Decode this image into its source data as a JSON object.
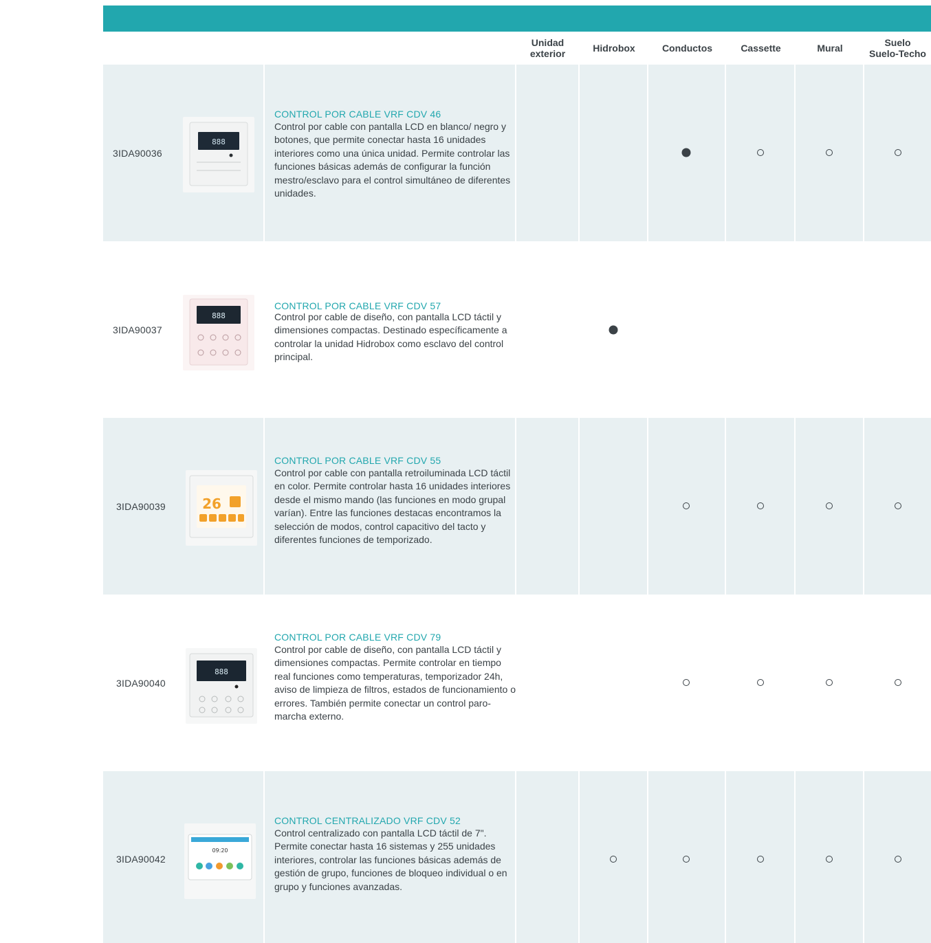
{
  "columns": {
    "unidad_exterior": "Unidad\nexterior",
    "hidrobox": "Hidrobox",
    "conductos": "Conductos",
    "cassette": "Cassette",
    "mural": "Mural",
    "suelo": "Suelo\nSuelo-Techo"
  },
  "rows": [
    {
      "code": "3IDA90036",
      "title": "CONTROL POR CABLE VRF CDV 46",
      "description": "Control por cable con pantalla LCD en blanco/ negro y botones, que permite conectar hasta 16 unidades interiores como una única unidad. Permite controlar las funciones básicas además de configurar la función mestro/esclavo para el control simultáneo de diferentes unidades.",
      "marks": {
        "unidad_exterior": "",
        "hidrobox": "",
        "conductos": "full",
        "cassette": "empty",
        "mural": "empty",
        "suelo": "empty"
      },
      "thumb_icon": "wired-controller-lcd-icon"
    },
    {
      "code": "3IDA90037",
      "title": "CONTROL POR CABLE VRF CDV 57",
      "description": "Control por cable de diseño, con pantalla LCD táctil y dimensiones compactas. Destinado específicamente a controlar la unidad Hidrobox como esclavo del control principal.",
      "marks": {
        "unidad_exterior": "",
        "hidrobox": "full",
        "conductos": "",
        "cassette": "",
        "mural": "",
        "suelo": ""
      },
      "thumb_icon": "wired-controller-pink-icon"
    },
    {
      "code": "3IDA90039",
      "title": "CONTROL POR CABLE VRF CDV 55",
      "description": "Control por cable con pantalla retroiluminada LCD táctil en color. Permite controlar hasta 16 unidades interiores desde el mismo mando (las funciones en modo grupal varían). Entre las funciones destacas encontramos la selección de modos, control capacitivo del tacto y diferentes funciones de temporizado.",
      "marks": {
        "unidad_exterior": "",
        "hidrobox": "",
        "conductos": "empty",
        "cassette": "empty",
        "mural": "empty",
        "suelo": "empty"
      },
      "thumb_icon": "color-touch-controller-icon",
      "thumb_text": "26"
    },
    {
      "code": "3IDA90040",
      "title": "CONTROL POR CABLE VRF CDV 79",
      "description": "Control por cable de diseño, con pantalla LCD táctil y dimensiones compactas. Permite controlar en tiempo real funciones como temperaturas, temporizador 24h, aviso de limpieza de filtros, estados de funcionamiento o errores. También permite conectar un control paro-marcha externo.",
      "marks": {
        "unidad_exterior": "",
        "hidrobox": "",
        "conductos": "empty",
        "cassette": "empty",
        "mural": "empty",
        "suelo": "empty"
      },
      "thumb_icon": "wired-controller-lcd-icon"
    },
    {
      "code": "3IDA90042",
      "title": "CONTROL CENTRALIZADO VRF CDV 52",
      "description": "Control centralizado con pantalla LCD táctil de 7\". Permite conectar hasta 16 sistemas y 255 unidades interiores, controlar las funciones básicas además de gestión de grupo, funciones de bloqueo individual o en grupo y funciones avanzadas.",
      "marks": {
        "unidad_exterior": "",
        "hidrobox": "empty",
        "conductos": "empty",
        "cassette": "empty",
        "mural": "empty",
        "suelo": "empty"
      },
      "thumb_icon": "centralized-touch-controller-icon",
      "thumb_text": "09:20"
    }
  ]
}
